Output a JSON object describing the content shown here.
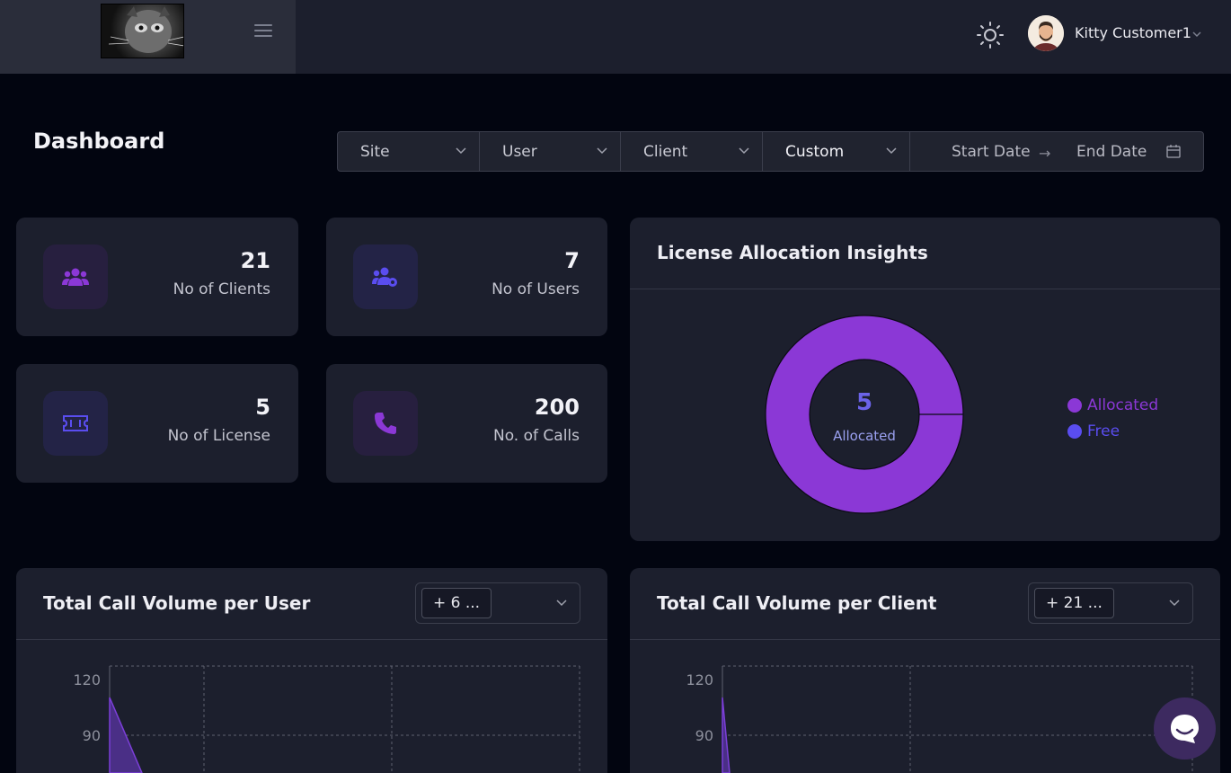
{
  "header": {
    "user_name": "Kitty Customer1"
  },
  "page": {
    "title": "Dashboard"
  },
  "filters": {
    "site": "Site",
    "user": "User",
    "client": "Client",
    "range": "Custom",
    "start_placeholder": "Start Date",
    "end_placeholder": "End Date",
    "arrow": "→"
  },
  "stats": [
    {
      "value": "21",
      "label": "No of Clients",
      "icon": "users-icon"
    },
    {
      "value": "7",
      "label": "No of Users",
      "icon": "users-cog-icon"
    },
    {
      "value": "5",
      "label": "No of License",
      "icon": "ticket-icon"
    },
    {
      "value": "200",
      "label": "No. of Calls",
      "icon": "phone-icon"
    }
  ],
  "license_panel": {
    "title": "License Allocation Insights",
    "center_value": "5",
    "center_label": "Allocated",
    "legend": [
      {
        "label": "Allocated",
        "color": "#8b38d6"
      },
      {
        "label": "Free",
        "color": "#5a4df0"
      }
    ]
  },
  "user_volume": {
    "title": "Total Call Volume per User",
    "selection": "+ 6 ..."
  },
  "client_volume": {
    "title": "Total Call Volume per Client",
    "selection": "+ 21 ..."
  },
  "chart_data": [
    {
      "type": "pie",
      "categories": [
        "Allocated",
        "Free"
      ],
      "values": [
        5,
        0
      ]
    },
    {
      "type": "area",
      "yticks": [
        120,
        90
      ],
      "partial": true
    },
    {
      "type": "area",
      "yticks": [
        120,
        90
      ],
      "partial": true
    }
  ],
  "colors": {
    "accent": "#8b38d6",
    "accent_alt": "#5a4df0",
    "card": "#1c1f2d",
    "page": "#020510"
  }
}
